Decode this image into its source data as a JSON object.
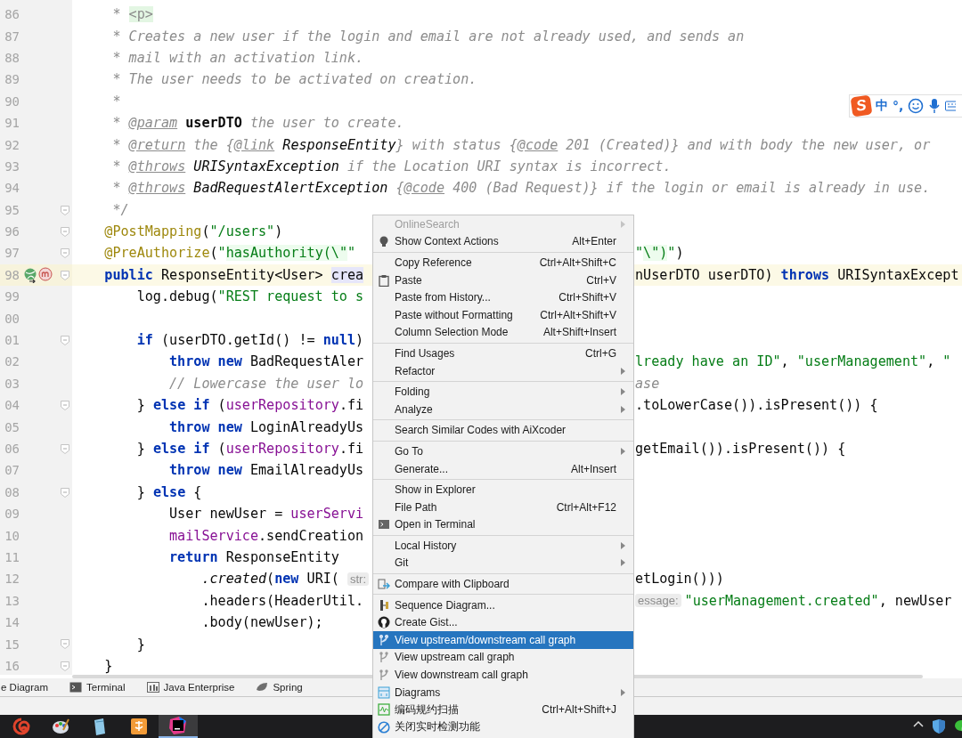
{
  "editor": {
    "lines": [
      {
        "number": "86",
        "current": false,
        "fold": false,
        "gutter_icons": false,
        "tokens": [
          {
            "kind": "doc",
            "text": "     * "
          },
          {
            "kind": "html",
            "text": "<p>"
          }
        ]
      },
      {
        "number": "87",
        "current": false,
        "fold": false,
        "gutter_icons": false,
        "tokens": [
          {
            "kind": "doc",
            "text": "     * Creates a new user if the login and email are not already used, and sends an"
          }
        ]
      },
      {
        "number": "88",
        "current": false,
        "fold": false,
        "gutter_icons": false,
        "tokens": [
          {
            "kind": "doc",
            "text": "     * mail with an activation link."
          }
        ]
      },
      {
        "number": "89",
        "current": false,
        "fold": false,
        "gutter_icons": false,
        "tokens": [
          {
            "kind": "doc",
            "text": "     * The user needs to be activated on creation."
          }
        ]
      },
      {
        "number": "90",
        "current": false,
        "fold": false,
        "gutter_icons": false,
        "tokens": [
          {
            "kind": "doc",
            "text": "     *"
          }
        ]
      },
      {
        "number": "91",
        "current": false,
        "fold": false,
        "gutter_icons": false,
        "tokens": [
          {
            "kind": "doc",
            "text": "     * "
          },
          {
            "kind": "doctag",
            "text": "@param"
          },
          {
            "kind": "docbold",
            "text": " userDTO"
          },
          {
            "kind": "doc",
            "text": " the user to create."
          }
        ]
      },
      {
        "number": "92",
        "current": false,
        "fold": false,
        "gutter_icons": false,
        "tokens": [
          {
            "kind": "doc",
            "text": "     * "
          },
          {
            "kind": "doctag",
            "text": "@return"
          },
          {
            "kind": "doc",
            "text": " the {"
          },
          {
            "kind": "doctag",
            "text": "@link"
          },
          {
            "kind": "docref",
            "text": " ResponseEntity"
          },
          {
            "kind": "doc",
            "text": "} with status {"
          },
          {
            "kind": "doctag",
            "text": "@code"
          },
          {
            "kind": "doc",
            "text": " 201 (Created)} and with body the new user, or"
          }
        ]
      },
      {
        "number": "93",
        "current": false,
        "fold": false,
        "gutter_icons": false,
        "tokens": [
          {
            "kind": "doc",
            "text": "     * "
          },
          {
            "kind": "doctag",
            "text": "@throws"
          },
          {
            "kind": "docref",
            "text": " URISyntaxException"
          },
          {
            "kind": "doc",
            "text": " if the Location URI syntax is incorrect."
          }
        ]
      },
      {
        "number": "94",
        "current": false,
        "fold": false,
        "gutter_icons": false,
        "tokens": [
          {
            "kind": "doc",
            "text": "     * "
          },
          {
            "kind": "doctag",
            "text": "@throws"
          },
          {
            "kind": "docref",
            "text": " BadRequestAlertException"
          },
          {
            "kind": "doc",
            "text": " {"
          },
          {
            "kind": "doctag",
            "text": "@code"
          },
          {
            "kind": "doc",
            "text": " 400 (Bad Request)} if the login or email is already in use."
          }
        ]
      },
      {
        "number": "95",
        "current": false,
        "fold": true,
        "gutter_icons": false,
        "tokens": [
          {
            "kind": "doc",
            "text": "     */"
          }
        ]
      },
      {
        "number": "96",
        "current": false,
        "fold": true,
        "gutter_icons": false,
        "tokens": [
          {
            "kind": "anno",
            "text": "    @PostMapping"
          },
          {
            "kind": "plain",
            "text": "("
          },
          {
            "kind": "str",
            "text": "\"/users\""
          },
          {
            "kind": "plain",
            "text": ")"
          }
        ]
      },
      {
        "number": "97",
        "current": false,
        "fold": true,
        "gutter_icons": false,
        "tokens": [
          {
            "kind": "anno",
            "text": "    @PreAuthorize"
          },
          {
            "kind": "plain",
            "text": "("
          },
          {
            "kind": "str",
            "text": "\""
          },
          {
            "kind": "inj",
            "text": "hasAuthority(\\\""
          },
          {
            "kind": "str",
            "text": "\""
          }
        ],
        "right": [
          {
            "kind": "str",
            "text": "\""
          },
          {
            "kind": "inj",
            "text": "\\\")"
          },
          {
            "kind": "str",
            "text": "\""
          },
          {
            "kind": "plain",
            "text": ")"
          }
        ]
      },
      {
        "number": "98",
        "current": true,
        "fold": true,
        "gutter_icons": true,
        "tokens": [
          {
            "kind": "kw",
            "text": "    public"
          },
          {
            "kind": "plain",
            "text": " ResponseEntity<User> "
          },
          {
            "kind": "sel",
            "text": "crea"
          }
        ],
        "right": [
          {
            "kind": "plain",
            "text": "nUserDTO userDTO) "
          },
          {
            "kind": "kw",
            "text": "throws"
          },
          {
            "kind": "plain",
            "text": " URISyntaxExcept"
          }
        ]
      },
      {
        "number": "99",
        "current": false,
        "fold": false,
        "gutter_icons": false,
        "tokens": [
          {
            "kind": "plain",
            "text": "        log.debug("
          },
          {
            "kind": "str",
            "text": "\"REST request to s"
          }
        ]
      },
      {
        "number": "00",
        "current": false,
        "fold": false,
        "gutter_icons": false
      },
      {
        "number": "01",
        "current": false,
        "fold": true,
        "gutter_icons": false,
        "tokens": [
          {
            "kind": "kw",
            "text": "        if"
          },
          {
            "kind": "plain",
            "text": " (userDTO.getId() != "
          },
          {
            "kind": "kw",
            "text": "null"
          },
          {
            "kind": "plain",
            "text": ")"
          }
        ]
      },
      {
        "number": "02",
        "current": false,
        "fold": false,
        "gutter_icons": false,
        "tokens": [
          {
            "kind": "kw",
            "text": "            throw new"
          },
          {
            "kind": "plain",
            "text": " BadRequestAler"
          }
        ],
        "right": [
          {
            "kind": "str",
            "text": "lready have an ID\""
          },
          {
            "kind": "plain",
            "text": ", "
          },
          {
            "kind": "str",
            "text": "\"userManagement\""
          },
          {
            "kind": "plain",
            "text": ", "
          },
          {
            "kind": "str",
            "text": "\""
          }
        ]
      },
      {
        "number": "03",
        "current": false,
        "fold": false,
        "gutter_icons": false,
        "tokens": [
          {
            "kind": "doc",
            "text": "            // Lowercase the user lo"
          }
        ],
        "right": [
          {
            "kind": "doc",
            "text": "ase"
          }
        ]
      },
      {
        "number": "04",
        "current": false,
        "fold": true,
        "gutter_icons": false,
        "tokens": [
          {
            "kind": "plain",
            "text": "        } "
          },
          {
            "kind": "kw",
            "text": "else if"
          },
          {
            "kind": "plain",
            "text": " ("
          },
          {
            "kind": "field",
            "text": "userRepository"
          },
          {
            "kind": "plain",
            "text": ".fi"
          }
        ],
        "right": [
          {
            "kind": "plain",
            "text": ".toLowerCase()).isPresent()) {"
          }
        ]
      },
      {
        "number": "05",
        "current": false,
        "fold": false,
        "gutter_icons": false,
        "tokens": [
          {
            "kind": "kw",
            "text": "            throw new"
          },
          {
            "kind": "plain",
            "text": " LoginAlreadyUs"
          }
        ]
      },
      {
        "number": "06",
        "current": false,
        "fold": true,
        "gutter_icons": false,
        "tokens": [
          {
            "kind": "plain",
            "text": "        } "
          },
          {
            "kind": "kw",
            "text": "else if"
          },
          {
            "kind": "plain",
            "text": " ("
          },
          {
            "kind": "field",
            "text": "userRepository"
          },
          {
            "kind": "plain",
            "text": ".fi"
          }
        ],
        "right": [
          {
            "kind": "plain",
            "text": "getEmail()).isPresent()) {"
          }
        ]
      },
      {
        "number": "07",
        "current": false,
        "fold": false,
        "gutter_icons": false,
        "tokens": [
          {
            "kind": "kw",
            "text": "            throw new"
          },
          {
            "kind": "plain",
            "text": " EmailAlreadyUs"
          }
        ]
      },
      {
        "number": "08",
        "current": false,
        "fold": true,
        "gutter_icons": false,
        "tokens": [
          {
            "kind": "plain",
            "text": "        } "
          },
          {
            "kind": "kw",
            "text": "else"
          },
          {
            "kind": "plain",
            "text": " {"
          }
        ]
      },
      {
        "number": "09",
        "current": false,
        "fold": false,
        "gutter_icons": false,
        "tokens": [
          {
            "kind": "plain",
            "text": "            User newUser = "
          },
          {
            "kind": "field",
            "text": "userServi"
          }
        ]
      },
      {
        "number": "10",
        "current": false,
        "fold": false,
        "gutter_icons": false,
        "tokens": [
          {
            "kind": "field",
            "text": "            mailService"
          },
          {
            "kind": "plain",
            "text": ".sendCreation"
          }
        ]
      },
      {
        "number": "11",
        "current": false,
        "fold": false,
        "gutter_icons": false,
        "tokens": [
          {
            "kind": "kw",
            "text": "            return"
          },
          {
            "kind": "plain",
            "text": " ResponseEntity"
          }
        ]
      },
      {
        "number": "12",
        "current": false,
        "fold": false,
        "gutter_icons": false,
        "tokens": [
          {
            "kind": "italic",
            "text": "                .created"
          },
          {
            "kind": "plain",
            "text": "("
          },
          {
            "kind": "kw",
            "text": "new"
          },
          {
            "kind": "plain",
            "text": " URI( "
          },
          {
            "kind": "hint",
            "text": "str:"
          }
        ],
        "right": [
          {
            "kind": "plain",
            "text": "etLogin()))"
          }
        ]
      },
      {
        "number": "13",
        "current": false,
        "fold": false,
        "gutter_icons": false,
        "tokens": [
          {
            "kind": "plain",
            "text": "                .headers(HeaderUtil."
          }
        ],
        "right": [
          {
            "kind": "hint",
            "text": "essage:"
          },
          {
            "kind": "str",
            "text": "\"userManagement.created\""
          },
          {
            "kind": "plain",
            "text": ", newUser"
          }
        ]
      },
      {
        "number": "14",
        "current": false,
        "fold": false,
        "gutter_icons": false,
        "tokens": [
          {
            "kind": "plain",
            "text": "                .body(newUser);"
          }
        ]
      },
      {
        "number": "15",
        "current": false,
        "fold": true,
        "gutter_icons": false,
        "tokens": [
          {
            "kind": "plain",
            "text": "        }"
          }
        ]
      },
      {
        "number": "16",
        "current": false,
        "fold": true,
        "gutter_icons": false,
        "tokens": [
          {
            "kind": "plain",
            "text": "    }"
          }
        ]
      }
    ]
  },
  "ime_toolbar": {
    "logo": "S",
    "labels": [
      "中",
      "°,"
    ]
  },
  "context_menu": {
    "groups": [
      [
        {
          "label": "OnlineSearch",
          "kind": "text",
          "submenu": true,
          "disabled": true,
          "selected": false
        },
        {
          "label": "Show Context Actions",
          "kind": "bulb",
          "shortcut": "Alt+Enter",
          "submenu": false,
          "disabled": false,
          "selected": false
        }
      ],
      [
        {
          "label": "Copy Reference",
          "kind": "text",
          "shortcut": "Ctrl+Alt+Shift+C",
          "submenu": false,
          "disabled": false,
          "selected": false
        },
        {
          "label": "Paste",
          "kind": "clipboard",
          "shortcut": "Ctrl+V",
          "submenu": false,
          "disabled": false,
          "selected": false
        },
        {
          "label": "Paste from History...",
          "kind": "text",
          "shortcut": "Ctrl+Shift+V",
          "submenu": false,
          "disabled": false,
          "selected": false
        },
        {
          "label": "Paste without Formatting",
          "kind": "text",
          "shortcut": "Ctrl+Alt+Shift+V",
          "submenu": false,
          "disabled": false,
          "selected": false
        },
        {
          "label": "Column Selection Mode",
          "kind": "text",
          "shortcut": "Alt+Shift+Insert",
          "submenu": false,
          "disabled": false,
          "selected": false
        }
      ],
      [
        {
          "label": "Find Usages",
          "kind": "text",
          "shortcut": "Ctrl+G",
          "submenu": false,
          "disabled": false,
          "selected": false
        },
        {
          "label": "Refactor",
          "kind": "text",
          "submenu": true,
          "disabled": false,
          "selected": false
        }
      ],
      [
        {
          "label": "Folding",
          "kind": "text",
          "submenu": true,
          "disabled": false,
          "selected": false
        },
        {
          "label": "Analyze",
          "kind": "text",
          "submenu": true,
          "disabled": false,
          "selected": false
        }
      ],
      [
        {
          "label": "Search Similar Codes with AiXcoder",
          "kind": "text",
          "submenu": false,
          "disabled": false,
          "selected": false
        }
      ],
      [
        {
          "label": "Go To",
          "kind": "text",
          "submenu": true,
          "disabled": false,
          "selected": false
        },
        {
          "label": "Generate...",
          "kind": "text",
          "shortcut": "Alt+Insert",
          "submenu": false,
          "disabled": false,
          "selected": false
        }
      ],
      [
        {
          "label": "Show in Explorer",
          "kind": "text",
          "submenu": false,
          "disabled": false,
          "selected": false
        },
        {
          "label": "File Path",
          "kind": "text",
          "shortcut": "Ctrl+Alt+F12",
          "submenu": false,
          "disabled": false,
          "selected": false
        },
        {
          "label": "Open in Terminal",
          "kind": "terminal",
          "submenu": false,
          "disabled": false,
          "selected": false
        }
      ],
      [
        {
          "label": "Local History",
          "kind": "text",
          "submenu": true,
          "disabled": false,
          "selected": false
        },
        {
          "label": "Git",
          "kind": "text",
          "submenu": true,
          "disabled": false,
          "selected": false
        }
      ],
      [
        {
          "label": "Compare with Clipboard",
          "kind": "compare",
          "submenu": false,
          "disabled": false,
          "selected": false
        }
      ],
      [
        {
          "label": "Sequence Diagram...",
          "kind": "sequence",
          "submenu": false,
          "disabled": false,
          "selected": false
        },
        {
          "label": "Create Gist...",
          "kind": "github",
          "submenu": false,
          "disabled": false,
          "selected": false
        },
        {
          "label": "View upstream/downstream call graph",
          "kind": "branch",
          "submenu": false,
          "disabled": false,
          "selected": true
        },
        {
          "label": "View upstream call graph",
          "kind": "branch",
          "submenu": false,
          "disabled": false,
          "selected": false
        },
        {
          "label": "View downstream call graph",
          "kind": "branch",
          "submenu": false,
          "disabled": false,
          "selected": false
        },
        {
          "label": "Diagrams",
          "kind": "diagram",
          "submenu": true,
          "disabled": false,
          "selected": false
        },
        {
          "label": "编码规约扫描",
          "kind": "scan",
          "shortcut": "Ctrl+Alt+Shift+J",
          "submenu": false,
          "disabled": false,
          "selected": false
        },
        {
          "label": "关闭实时检测功能",
          "kind": "forbid",
          "submenu": false,
          "disabled": false,
          "selected": false
        }
      ]
    ]
  },
  "tool_windows": [
    {
      "label": "e Diagram",
      "kind": "text"
    },
    {
      "label": "Terminal",
      "kind": "terminal"
    },
    {
      "label": "Java Enterprise",
      "kind": "enterprise"
    },
    {
      "label": "Spring",
      "kind": "spring"
    }
  ],
  "taskbar": {
    "apps": [
      {
        "kind": "snail",
        "selected": false
      },
      {
        "kind": "palette",
        "selected": false
      },
      {
        "kind": "notepad",
        "selected": false
      },
      {
        "kind": "reader",
        "selected": false
      },
      {
        "kind": "ide",
        "selected": true
      }
    ],
    "tray": [
      {
        "kind": "caret"
      },
      {
        "kind": "shield"
      },
      {
        "kind": "chat"
      }
    ]
  }
}
